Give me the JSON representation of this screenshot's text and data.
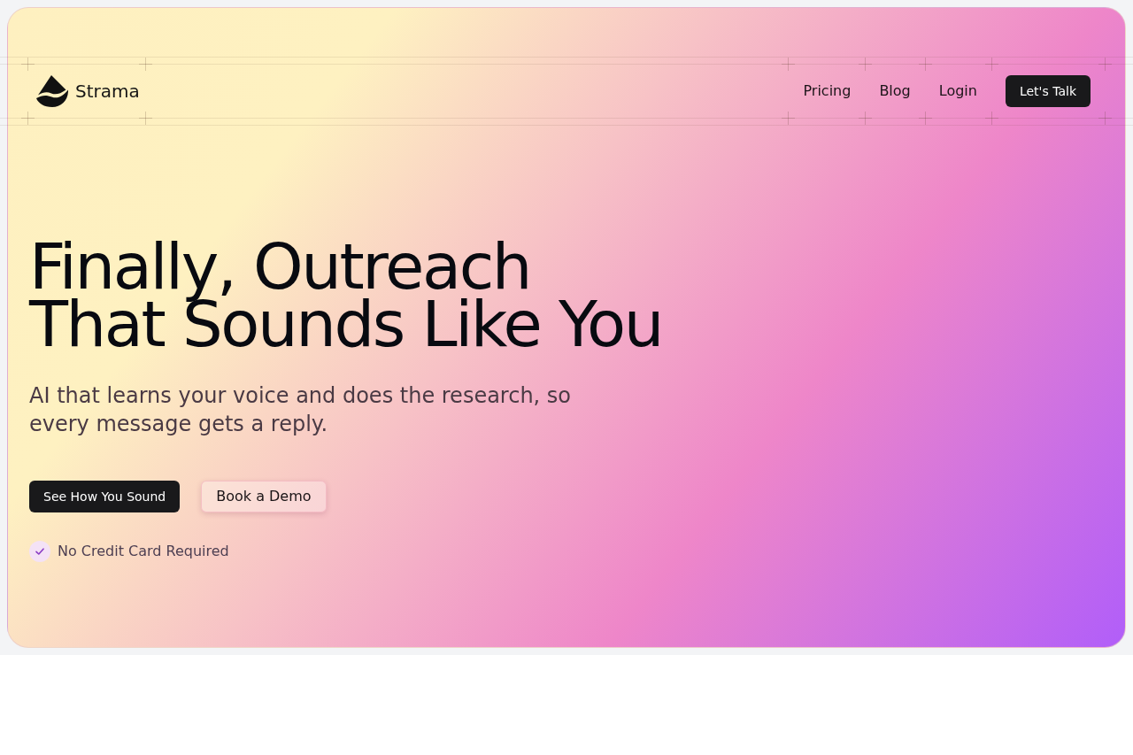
{
  "nav": {
    "brand": "Strama",
    "links": [
      {
        "label": "Pricing"
      },
      {
        "label": "Blog"
      },
      {
        "label": "Login"
      }
    ],
    "cta": "Let's Talk"
  },
  "hero": {
    "headline": [
      "Finally, Outreach",
      "That Sounds Like You"
    ],
    "subtitle": "AI that learns your voice and does the research, so every message gets a reply.",
    "buttons": [
      {
        "label": "See How You Sound",
        "kind": "primary"
      },
      {
        "label": "Book a Demo",
        "kind": "secondary"
      }
    ],
    "note": "No Credit Card Required"
  }
}
